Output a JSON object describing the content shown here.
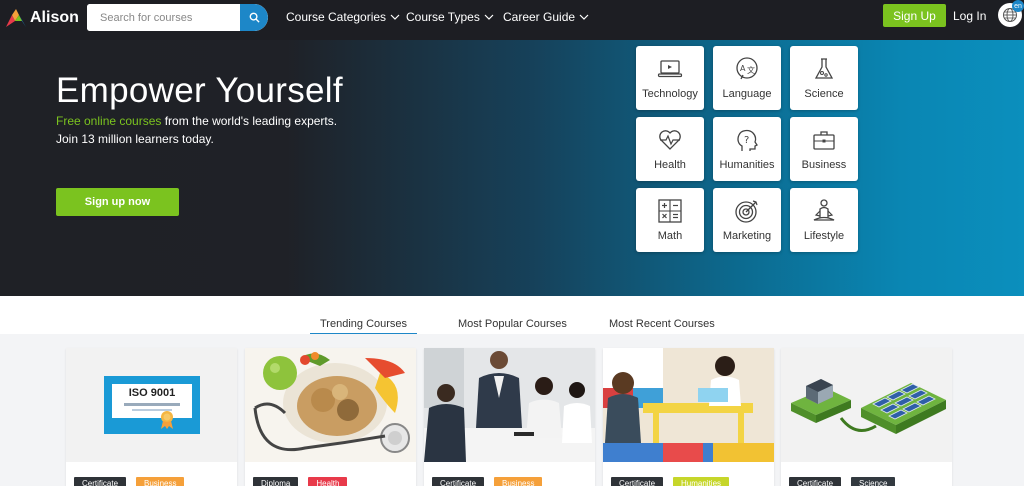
{
  "header": {
    "brand": "Alison",
    "search_placeholder": "Search for courses",
    "nav": [
      {
        "label": "Course Categories"
      },
      {
        "label": "Course Types"
      },
      {
        "label": "Career Guide"
      }
    ],
    "signup_label": "Sign Up",
    "login_label": "Log In",
    "language": "en"
  },
  "hero": {
    "title": "Empower Yourself",
    "subtitle_highlight": "Free online courses",
    "subtitle_rest": " from the world's leading experts.",
    "subtitle_line2": "Join 13 million learners today.",
    "cta_label": "Sign up now"
  },
  "categories": [
    {
      "label": "Technology",
      "icon": "laptop-icon"
    },
    {
      "label": "Language",
      "icon": "translate-icon"
    },
    {
      "label": "Science",
      "icon": "flask-icon"
    },
    {
      "label": "Health",
      "icon": "heartbeat-icon"
    },
    {
      "label": "Humanities",
      "icon": "head-question-icon"
    },
    {
      "label": "Business",
      "icon": "briefcase-icon"
    },
    {
      "label": "Math",
      "icon": "calculator-icon"
    },
    {
      "label": "Marketing",
      "icon": "target-icon"
    },
    {
      "label": "Lifestyle",
      "icon": "meditation-icon"
    }
  ],
  "tabs": [
    {
      "label": "Trending Courses",
      "active": true
    },
    {
      "label": "Most Popular Courses",
      "active": false
    },
    {
      "label": "Most Recent Courses",
      "active": false
    }
  ],
  "courses": [
    {
      "type": "Certificate",
      "category": "Business",
      "category_color": "#f5a03a",
      "image_text": "ISO 9001"
    },
    {
      "type": "Diploma",
      "category": "Health",
      "category_color": "#e83a4a"
    },
    {
      "type": "Certificate",
      "category": "Business",
      "category_color": "#f5a03a"
    },
    {
      "type": "Certificate",
      "category": "Humanities",
      "category_color": "#c6d62a"
    },
    {
      "type": "Certificate",
      "category": "Science",
      "category_color": "#333a40"
    }
  ],
  "colors": {
    "accent_green": "#7bc31f",
    "accent_blue": "#1d87c8",
    "dark_nav": "#1d1e23",
    "tag_dark": "#2f3338"
  }
}
